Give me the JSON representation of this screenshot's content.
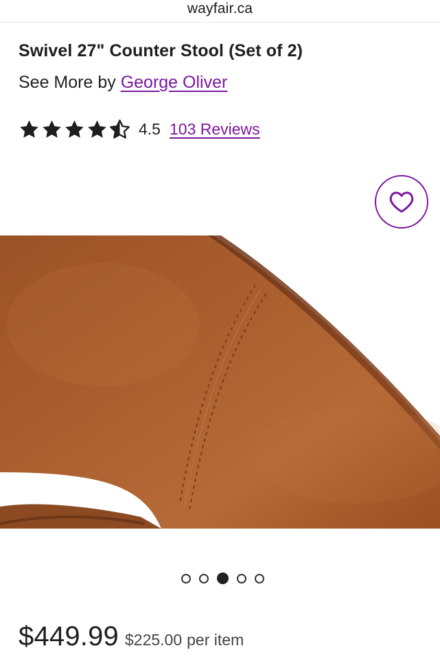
{
  "browser": {
    "url": "wayfair.ca"
  },
  "product": {
    "title": "Swivel 27\" Counter Stool (Set of 2)",
    "brand_prefix": "See More by",
    "brand_name": "George Oliver",
    "rating_value": "4.5",
    "rating_stars": 4.5,
    "reviews_label": "103 Reviews",
    "price": "$449.99",
    "unit_price": "$225.00",
    "unit_label": "per item"
  },
  "gallery": {
    "image_count": 5,
    "active_index": 2
  },
  "colors": {
    "accent": "#7b189f",
    "leather": "#a65a2c",
    "text": "#222222"
  },
  "icons": {
    "favorite": "heart-outline-icon",
    "star_full": "star-filled-icon",
    "star_half": "star-half-icon"
  }
}
